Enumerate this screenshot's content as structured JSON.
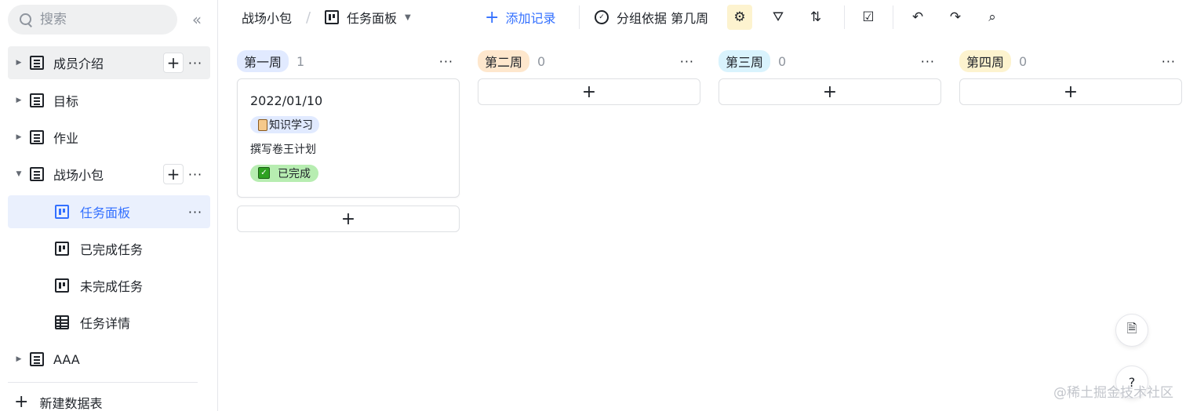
{
  "sidebar": {
    "search_placeholder": "搜索",
    "collapse_glyph": "«",
    "items": [
      {
        "label": "成员介绍"
      },
      {
        "label": "目标"
      },
      {
        "label": "作业"
      },
      {
        "label": "战场小包"
      },
      {
        "label": "任务面板"
      },
      {
        "label": "已完成任务"
      },
      {
        "label": "未完成任务"
      },
      {
        "label": "任务详情"
      },
      {
        "label": "AAA"
      }
    ],
    "new_table": "新建数据表"
  },
  "toolbar": {
    "breadcrumb_parent": "战场小包",
    "breadcrumb_sep": "/",
    "view_name": "任务面板",
    "add_record": "添加记录",
    "group_by": "分组依据 第几周"
  },
  "board": {
    "columns": [
      {
        "name": "第一周",
        "count": "1",
        "color": "#e1eaff"
      },
      {
        "name": "第二周",
        "count": "0",
        "color": "#fee7cd"
      },
      {
        "name": "第三周",
        "count": "0",
        "color": "#d9f3fd"
      },
      {
        "name": "第四周",
        "count": "0",
        "color": "#fdf3cf"
      }
    ],
    "cards": [
      {
        "date": "2022/01/10",
        "tag": "知识学习",
        "tag_color": "#e1eaff",
        "title": "撰写卷王计划",
        "status": "已完成",
        "status_color": "#b7edb1"
      }
    ]
  },
  "watermark": "@稀土掘金技术社区"
}
